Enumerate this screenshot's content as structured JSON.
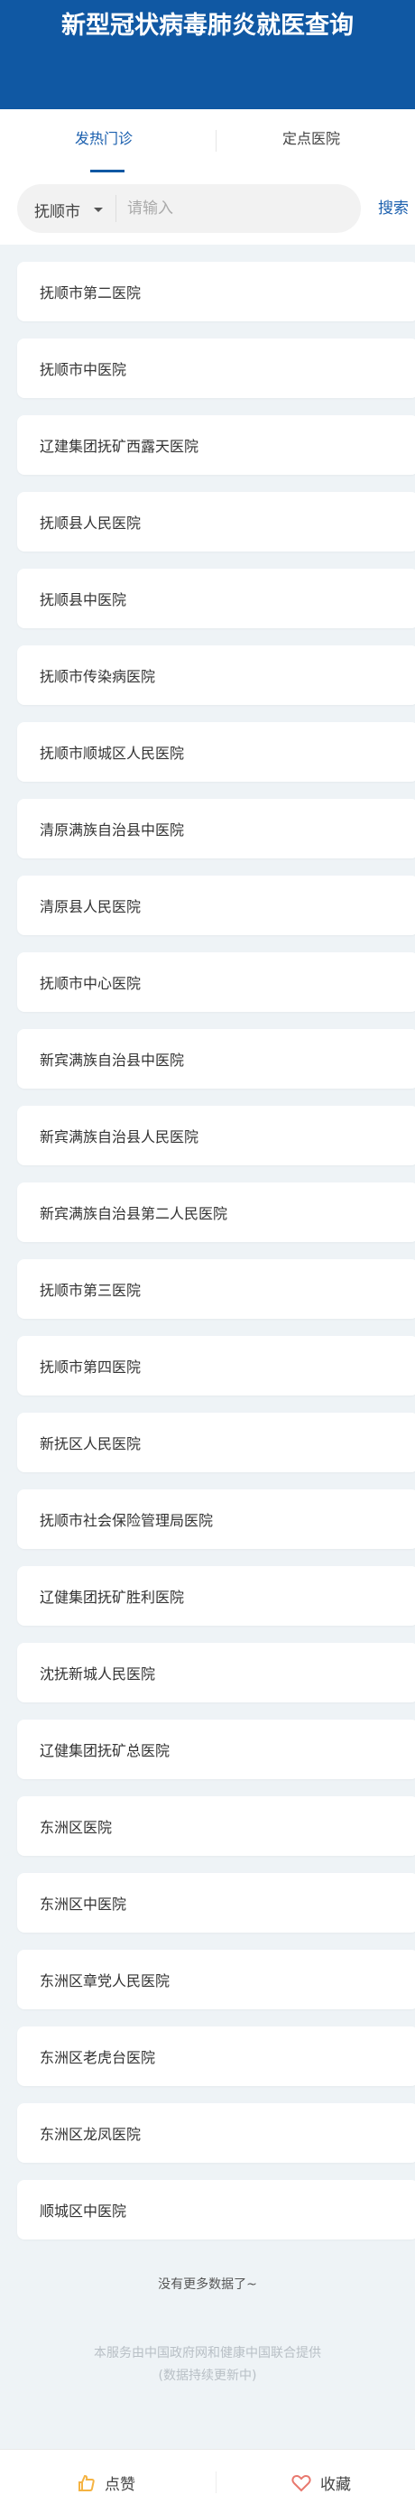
{
  "header": {
    "title": "新型冠状病毒肺炎就医查询"
  },
  "tabs": [
    {
      "label": "发热门诊",
      "active": true
    },
    {
      "label": "定点医院",
      "active": false
    }
  ],
  "search": {
    "city": "抚顺市",
    "placeholder": "请输入",
    "value": "",
    "button": "搜索"
  },
  "hospitals": [
    "抚顺市第二医院",
    "抚顺市中医院",
    "辽建集团抚矿西露天医院",
    "抚顺县人民医院",
    "抚顺县中医院",
    "抚顺市传染病医院",
    "抚顺市顺城区人民医院",
    "清原满族自治县中医院",
    "清原县人民医院",
    "抚顺市中心医院",
    "新宾满族自治县中医院",
    "新宾满族自治县人民医院",
    "新宾满族自治县第二人民医院",
    "抚顺市第三医院",
    "抚顺市第四医院",
    "新抚区人民医院",
    "抚顺市社会保险管理局医院",
    "辽健集团抚矿胜利医院",
    "沈抚新城人民医院",
    "辽健集团抚矿总医院",
    "东洲区医院",
    "东洲区中医院",
    "东洲区章党人民医院",
    "东洲区老虎台医院",
    "东洲区龙凤医院",
    "顺城区中医院"
  ],
  "list_end": "没有更多数据了~",
  "footer": {
    "line1": "本服务由中国政府网和健康中国联合提供",
    "line2": "(数据持续更新中)"
  },
  "bottom": {
    "like": "点赞",
    "favorite": "收藏"
  },
  "colors": {
    "brand": "#1058a3",
    "like": "#f5b342",
    "heart": "#e8786e"
  }
}
